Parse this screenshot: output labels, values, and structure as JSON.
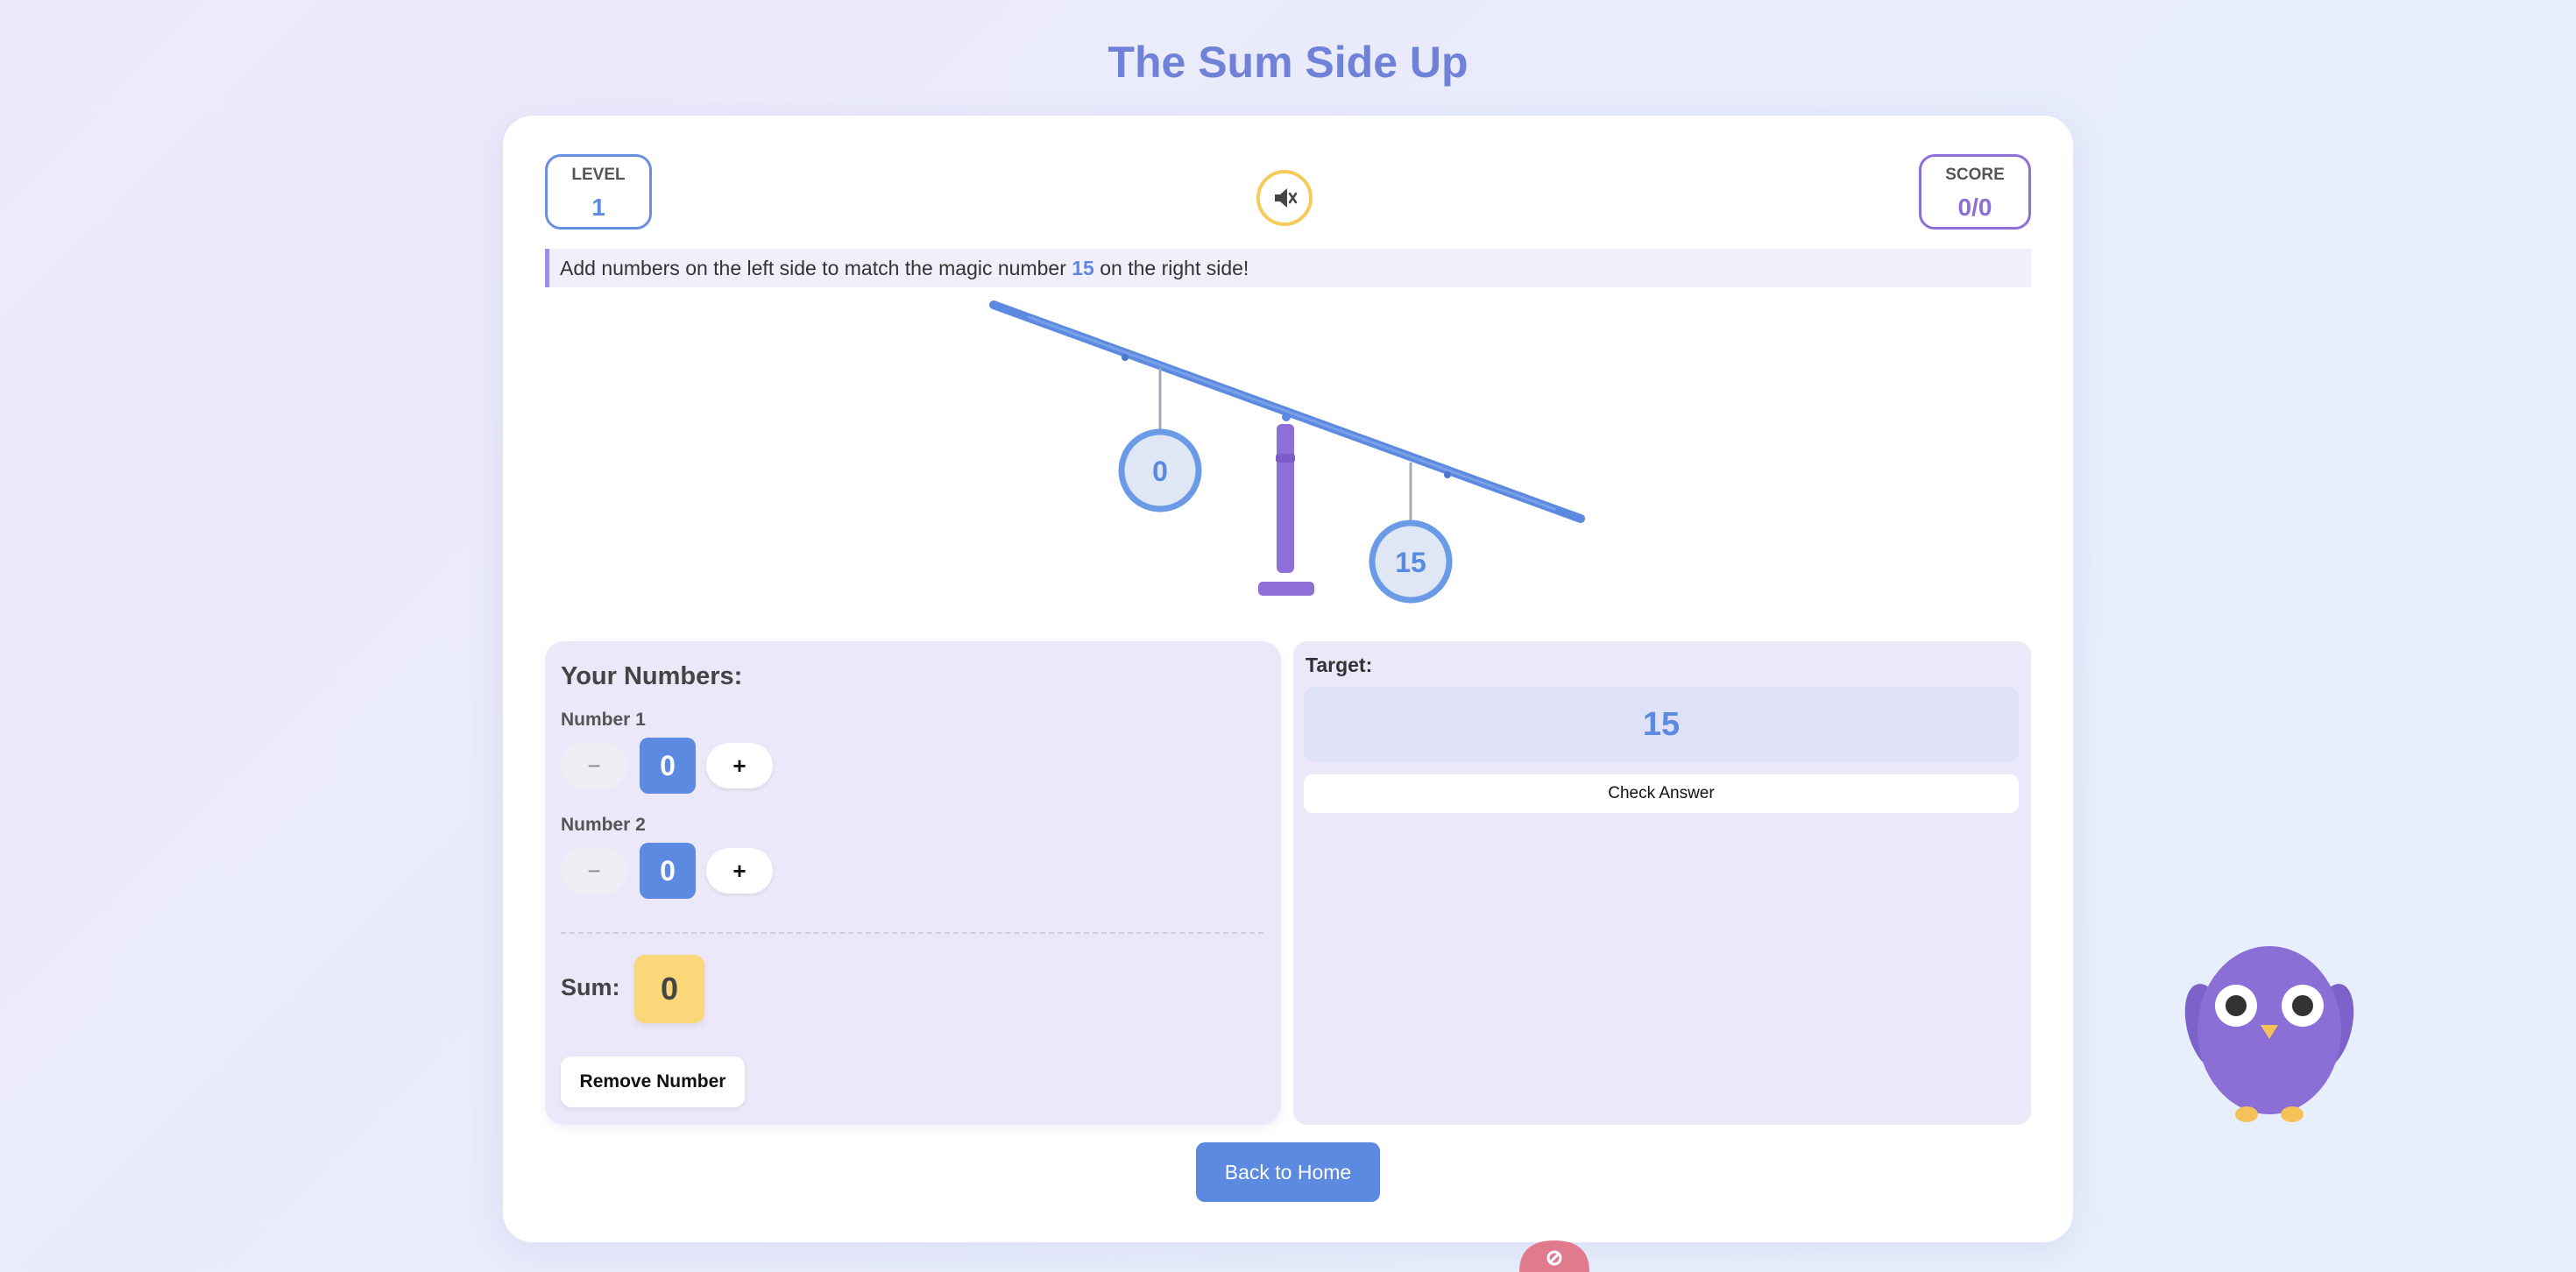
{
  "page": {
    "title": "The Sum Side Up"
  },
  "stats": {
    "level_label": "LEVEL",
    "level_value": "1",
    "score_label": "SCORE",
    "score_value": "0/0"
  },
  "sound": {
    "icon": "speaker-muted-icon"
  },
  "instruction": {
    "before": "Add numbers on the left side to match the magic number ",
    "magic": "15",
    "after": " on the right side!"
  },
  "scale": {
    "left_weight": "0",
    "right_weight": "15"
  },
  "numbers_panel": {
    "title": "Your Numbers:",
    "numbers": [
      {
        "label": "Number 1",
        "value": "0",
        "minus": "−",
        "plus": "+"
      },
      {
        "label": "Number 2",
        "value": "0",
        "minus": "−",
        "plus": "+"
      }
    ],
    "sum_label": "Sum:",
    "sum_value": "0",
    "remove_label": "Remove Number"
  },
  "target_panel": {
    "label": "Target:",
    "value": "15",
    "check_label": "Check Answer"
  },
  "home_label": "Back to Home",
  "colors": {
    "primary": "#5b8ae0",
    "accent": "#8e6fd8",
    "sum": "#fcd779",
    "title": "#6f82d8"
  }
}
